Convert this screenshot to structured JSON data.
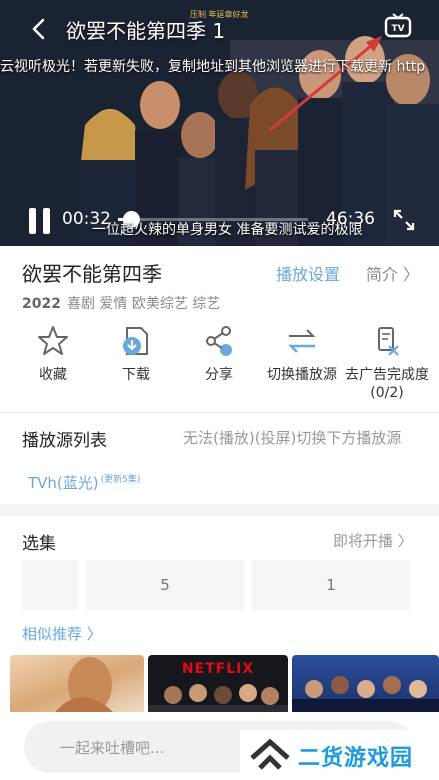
{
  "player": {
    "title": "欲罢不能第四季 1",
    "watermark": "压制 年延章好龙",
    "marquee": "云视听极光！若更新失败，复制地址到其他浏览器进行下载更新 http",
    "subtitle": "一位超火辣的单身男女 准备要测试爱的极限",
    "current_time": "00:32",
    "total_time": "46:36",
    "progress": 0.07
  },
  "show": {
    "title": "欲罢不能第四季",
    "settings_label": "播放设置",
    "intro_label": "简介 〉",
    "year": "2022",
    "genres": "喜剧 爱情 欧美综艺 综艺"
  },
  "actions": [
    {
      "label": "收藏",
      "icon": "star-icon"
    },
    {
      "label": "下载",
      "icon": "download-icon"
    },
    {
      "label": "分享",
      "icon": "share-icon"
    },
    {
      "label": "切换播放源",
      "icon": "switch-icon"
    },
    {
      "label": "去广告完成度",
      "sub": "(0/2)",
      "icon": "ad-remove-icon"
    }
  ],
  "sources": {
    "title": "播放源列表",
    "hint": "无法(播放)(投屏)切换下方播放源",
    "items": [
      {
        "label": "TVh(蓝光)",
        "badge": "(更新5集)"
      }
    ]
  },
  "episodes": {
    "title": "选集",
    "link": "即将开播 〉",
    "items": [
      "",
      "5",
      "1",
      ""
    ]
  },
  "recommend": {
    "title": "相似推荐 〉",
    "thumb_text": "NETFLIX"
  },
  "comment": {
    "placeholder": "一起来吐槽吧..."
  },
  "brand": {
    "name": "二货游戏园"
  },
  "colors": {
    "accent": "#6aa9dd",
    "brand": "#1e9be0",
    "netflix": "#e50914"
  }
}
